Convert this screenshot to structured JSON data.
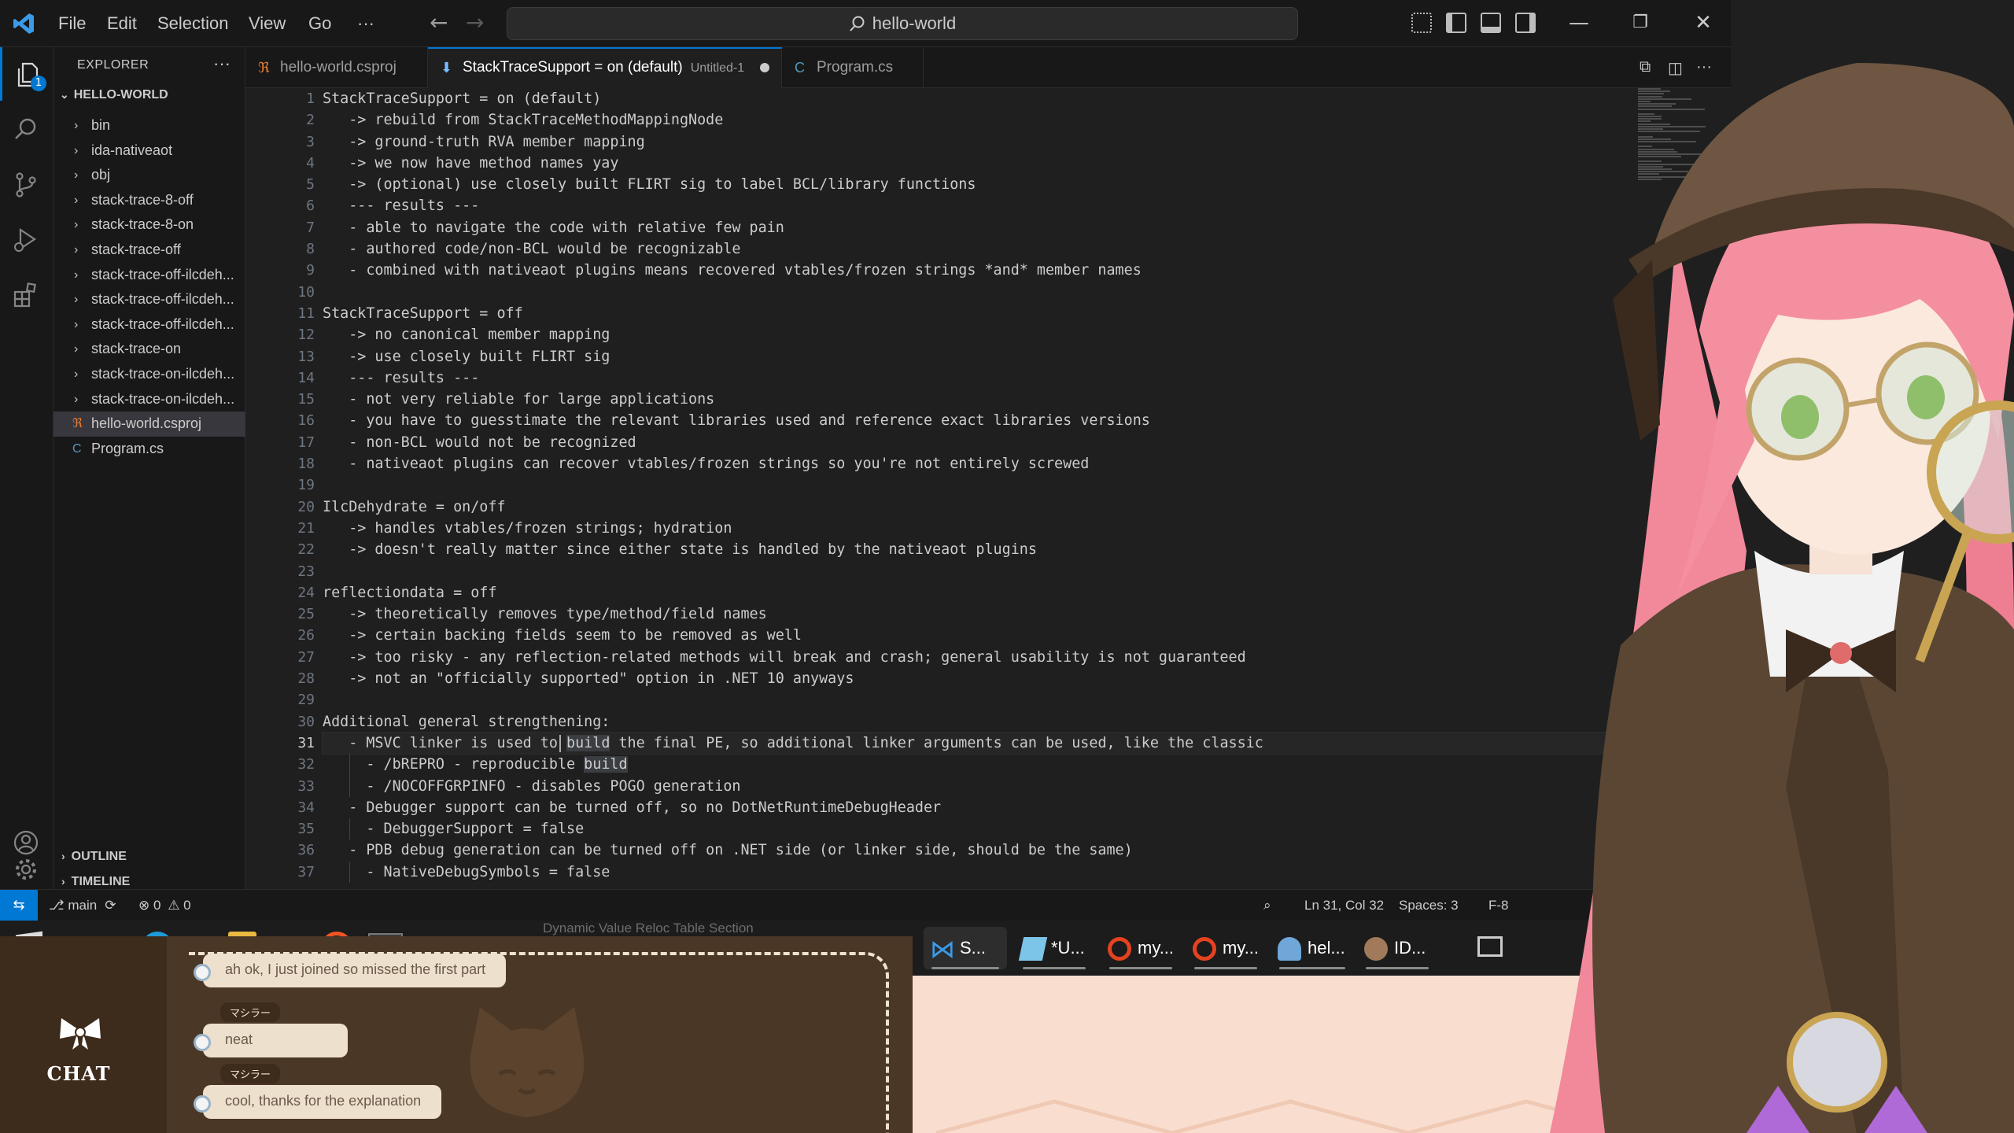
{
  "menu": [
    "File",
    "Edit",
    "Selection",
    "View",
    "Go",
    "···"
  ],
  "command_center": "hello-world",
  "explorer": {
    "title": "EXPLORER",
    "more": "···",
    "root": "HELLO-WORLD",
    "items": [
      {
        "label": "bin",
        "type": "folder"
      },
      {
        "label": "ida-nativeaot",
        "type": "folder"
      },
      {
        "label": "obj",
        "type": "folder"
      },
      {
        "label": "stack-trace-8-off",
        "type": "folder"
      },
      {
        "label": "stack-trace-8-on",
        "type": "folder"
      },
      {
        "label": "stack-trace-off",
        "type": "folder"
      },
      {
        "label": "stack-trace-off-ilcdeh...",
        "type": "folder"
      },
      {
        "label": "stack-trace-off-ilcdeh...",
        "type": "folder"
      },
      {
        "label": "stack-trace-off-ilcdeh...",
        "type": "folder"
      },
      {
        "label": "stack-trace-on",
        "type": "folder"
      },
      {
        "label": "stack-trace-on-ilcdeh...",
        "type": "folder"
      },
      {
        "label": "stack-trace-on-ilcdeh...",
        "type": "folder"
      },
      {
        "label": "hello-world.csproj",
        "type": "rss-file",
        "selected": true
      },
      {
        "label": "Program.cs",
        "type": "csharp-file"
      }
    ],
    "outline": "OUTLINE",
    "timeline": "TIMELINE",
    "badge": "1"
  },
  "tabs": [
    {
      "label": "hello-world.csproj",
      "icon": "rss-icon",
      "desc": "",
      "dirty": false,
      "active": false
    },
    {
      "label": "StackTraceSupport = on (default)",
      "icon": "pin-icon",
      "desc": "Untitled-1",
      "dirty": true,
      "active": true
    },
    {
      "label": "Program.cs",
      "icon": "csharp-icon",
      "desc": "",
      "dirty": false,
      "active": false
    }
  ],
  "editor": {
    "current_line": 31,
    "lines": [
      "StackTraceSupport = on (default)",
      "   -> rebuild from StackTraceMethodMappingNode",
      "   -> ground-truth RVA member mapping",
      "   -> we now have method names yay",
      "   -> (optional) use closely built FLIRT sig to label BCL/library functions",
      "   --- results ---",
      "   - able to navigate the code with relative few pain",
      "   - authored code/non-BCL would be recognizable",
      "   - combined with nativeaot plugins means recovered vtables/frozen strings *and* member names",
      "",
      "StackTraceSupport = off",
      "   -> no canonical member mapping",
      "   -> use closely built FLIRT sig",
      "   --- results ---",
      "   - not very reliable for large applications",
      "   - you have to guesstimate the relevant libraries used and reference exact libraries versions",
      "   - non-BCL would not be recognized",
      "   - nativeaot plugins can recover vtables/frozen strings so you're not entirely screwed",
      "",
      "IlcDehydrate = on/off",
      "   -> handles vtables/frozen strings; hydration",
      "   -> doesn't really matter since either state is handled by the nativeaot plugins",
      "",
      "reflectiondata = off",
      "   -> theoretically removes type/method/field names",
      "   -> certain backing fields seem to be removed as well",
      "   -> too risky - any reflection-related methods will break and crash; general usability is not guaranteed",
      "   -> not an \"officially supported\" option in .NET 10 anyways",
      "",
      "Additional general strengthening:",
      "   - MSVC linker is used to build the final PE, so additional linker arguments can be used, like the classic",
      "     - /bREPRO - reproducible build",
      "     - /NOCOFFGRPINFO - disables POGO generation",
      "   - Debugger support can be turned off, so no DotNetRuntimeDebugHeader",
      "     - DebuggerSupport = false",
      "   - PDB debug generation can be turned off on .NET side (or linker side, should be the same)",
      "     - NativeDebugSymbols = false"
    ]
  },
  "status": {
    "branch": "main",
    "errors": "0",
    "warnings": "0",
    "position": "Ln 31, Col 32",
    "spaces": "Spaces: 3",
    "encoding": "F-8"
  },
  "taskbar": [
    {
      "label": "S...",
      "icon": "vscode-icon"
    },
    {
      "label": "*U...",
      "icon": "notepad-icon"
    },
    {
      "label": "my...",
      "icon": "search-app-icon"
    },
    {
      "label": "my...",
      "icon": "search-app-icon"
    },
    {
      "label": "hel...",
      "icon": "user-app-icon"
    },
    {
      "label": "ID...",
      "icon": "ida-icon"
    }
  ],
  "taskbar_ghost_text": "Dynamic Value Reloc Table Section",
  "chat": {
    "label": "CHAT",
    "messages": [
      {
        "user": "",
        "text": "ah ok, I just joined so missed the first part"
      },
      {
        "user": "マシラー",
        "text": "neat"
      },
      {
        "user": "マシラー",
        "text": "cool, thanks for the explanation"
      }
    ]
  },
  "colors": {
    "accent": "#0078d4",
    "chat_bg": "#4b3726",
    "chat_bubble": "#ede0cc",
    "hair": "#f2899a"
  }
}
